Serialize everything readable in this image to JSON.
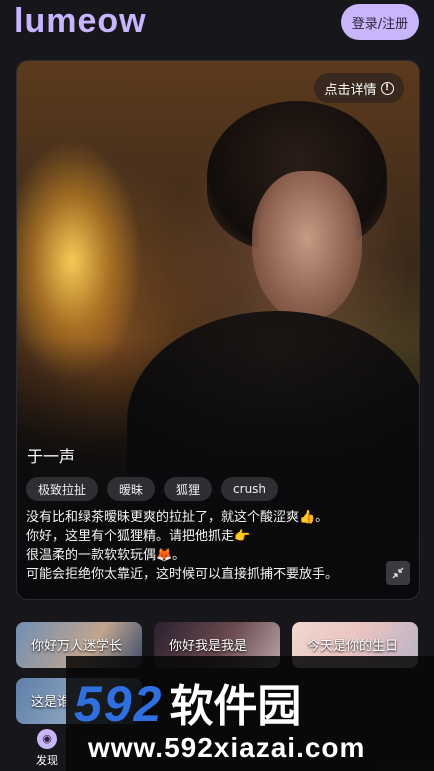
{
  "header": {
    "logo": "lumeow",
    "login_label": "登录/注册"
  },
  "card": {
    "details_label": "点击详情",
    "name": "于一声",
    "tags": [
      "极致拉扯",
      "暧昧",
      "狐狸",
      "crush"
    ],
    "description": [
      "没有比和绿茶暧昧更爽的拉扯了，就这个酸涩爽👍。",
      "你好，这里有个狐狸精。请把他抓走👉",
      "很温柔的一款软软玩偶🦊。",
      "可能会拒绝你太靠近，这时候可以直接抓捕不要放手。"
    ]
  },
  "thumbnails": [
    {
      "label": "你好万人迷学长"
    },
    {
      "label": "你好我是我是"
    },
    {
      "label": "今天是你的生日"
    },
    {
      "label": "这是谁"
    }
  ],
  "bottom_nav": {
    "discover_label": "发现"
  },
  "watermark": {
    "brand": "592",
    "brand_cn": "软件园",
    "url": "www.592xiazai.com"
  }
}
